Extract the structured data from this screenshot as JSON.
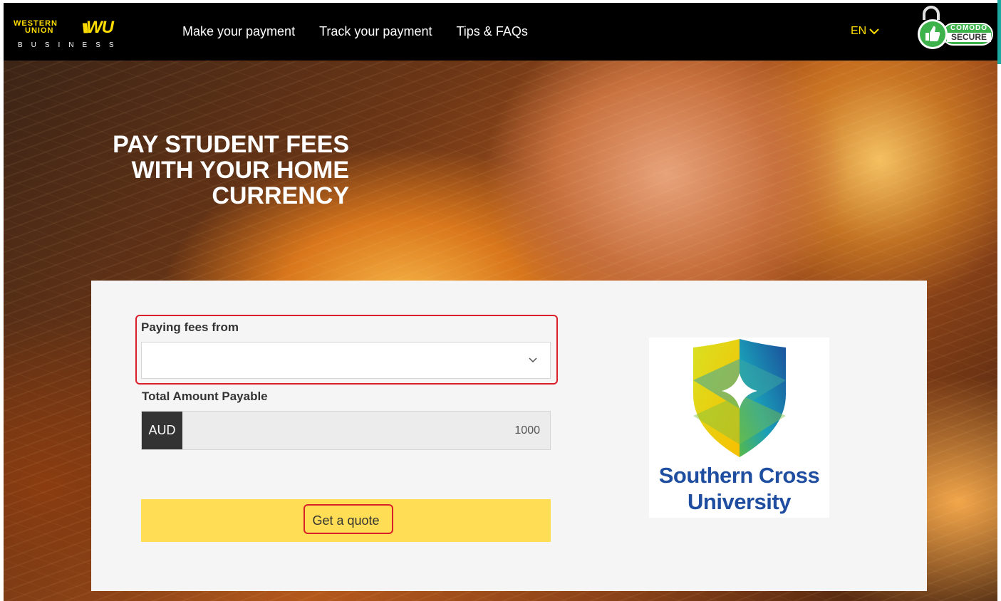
{
  "header": {
    "logo": {
      "line1": "WESTERN",
      "line2": "UNION",
      "mark": "WU",
      "sub": "BUSINESS"
    },
    "nav": [
      {
        "label": "Make your payment"
      },
      {
        "label": "Track your payment"
      },
      {
        "label": "Tips & FAQs"
      }
    ],
    "language": "EN",
    "badge": {
      "top": "COMODO",
      "bottom": "SECURE"
    }
  },
  "hero": {
    "title_lines": [
      "PAY STUDENT FEES",
      "WITH YOUR HOME",
      "CURRENCY"
    ]
  },
  "form": {
    "paying_from_label": "Paying fees from",
    "paying_from_value": "",
    "total_label": "Total Amount Payable",
    "currency": "AUD",
    "amount": "1000",
    "quote_button": "Get a quote"
  },
  "university": {
    "name_line1": "Southern Cross",
    "name_line2": "University"
  },
  "colors": {
    "brand_yellow": "#ffdd00",
    "button_yellow": "#ffdd55",
    "highlight_red": "#d9202a",
    "university_blue": "#1f4ea1"
  },
  "icons": {
    "language_dropdown": "chevron-down-icon",
    "select_dropdown": "chevron-down-icon",
    "badge": "thumbs-up-icon"
  }
}
